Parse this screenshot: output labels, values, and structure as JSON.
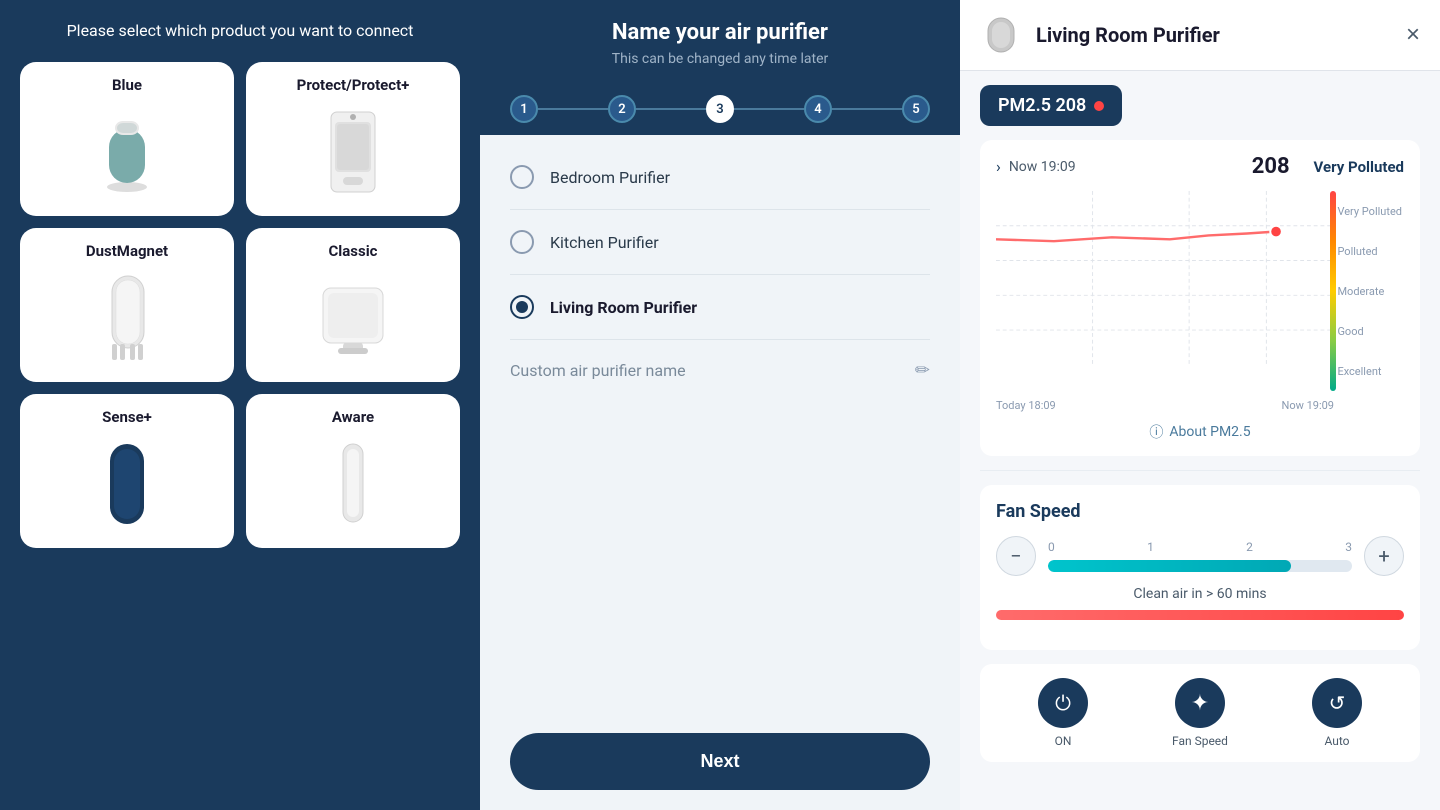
{
  "left": {
    "header": "Please select which product you want to connect",
    "products": [
      {
        "id": "blue",
        "name": "Blue"
      },
      {
        "id": "protect",
        "name": "Protect/Protect+"
      },
      {
        "id": "dustmagnet",
        "name": "DustMagnet"
      },
      {
        "id": "classic",
        "name": "Classic"
      },
      {
        "id": "senseplus",
        "name": "Sense+"
      },
      {
        "id": "aware",
        "name": "Aware"
      }
    ]
  },
  "middle": {
    "title": "Name your air purifier",
    "subtitle": "This can be changed any time later",
    "steps": [
      "1",
      "2",
      "3",
      "4",
      "5"
    ],
    "active_step": 3,
    "options": [
      {
        "id": "bedroom",
        "label": "Bedroom Purifier",
        "selected": false
      },
      {
        "id": "kitchen",
        "label": "Kitchen Purifier",
        "selected": false
      },
      {
        "id": "living",
        "label": "Living Room Purifier",
        "selected": true
      }
    ],
    "custom_label": "Custom air purifier name",
    "next_label": "Next"
  },
  "right": {
    "device_name": "Living Room Purifier",
    "close_label": "×",
    "pm_badge": "PM2.5 208",
    "aq_time": "Now 19:09",
    "aq_value": "208",
    "aq_status": "Very Polluted",
    "chart": {
      "x_start": "Today 18:09",
      "x_end": "Now 19:09",
      "labels": [
        "Very Polluted",
        "Polluted",
        "Moderate",
        "Good",
        "Excellent"
      ]
    },
    "about_pm": "About PM2.5",
    "fan_speed": {
      "title": "Fan Speed",
      "scale": [
        "0",
        "1",
        "2",
        "3"
      ],
      "fill_pct": 80
    },
    "clean_air": "Clean air in  > 60 mins",
    "controls": [
      {
        "id": "power",
        "label": "ON",
        "icon": "⏻"
      },
      {
        "id": "fanspeed",
        "label": "Fan Speed",
        "icon": "✦"
      },
      {
        "id": "auto",
        "label": "Auto",
        "icon": "↺"
      }
    ]
  }
}
